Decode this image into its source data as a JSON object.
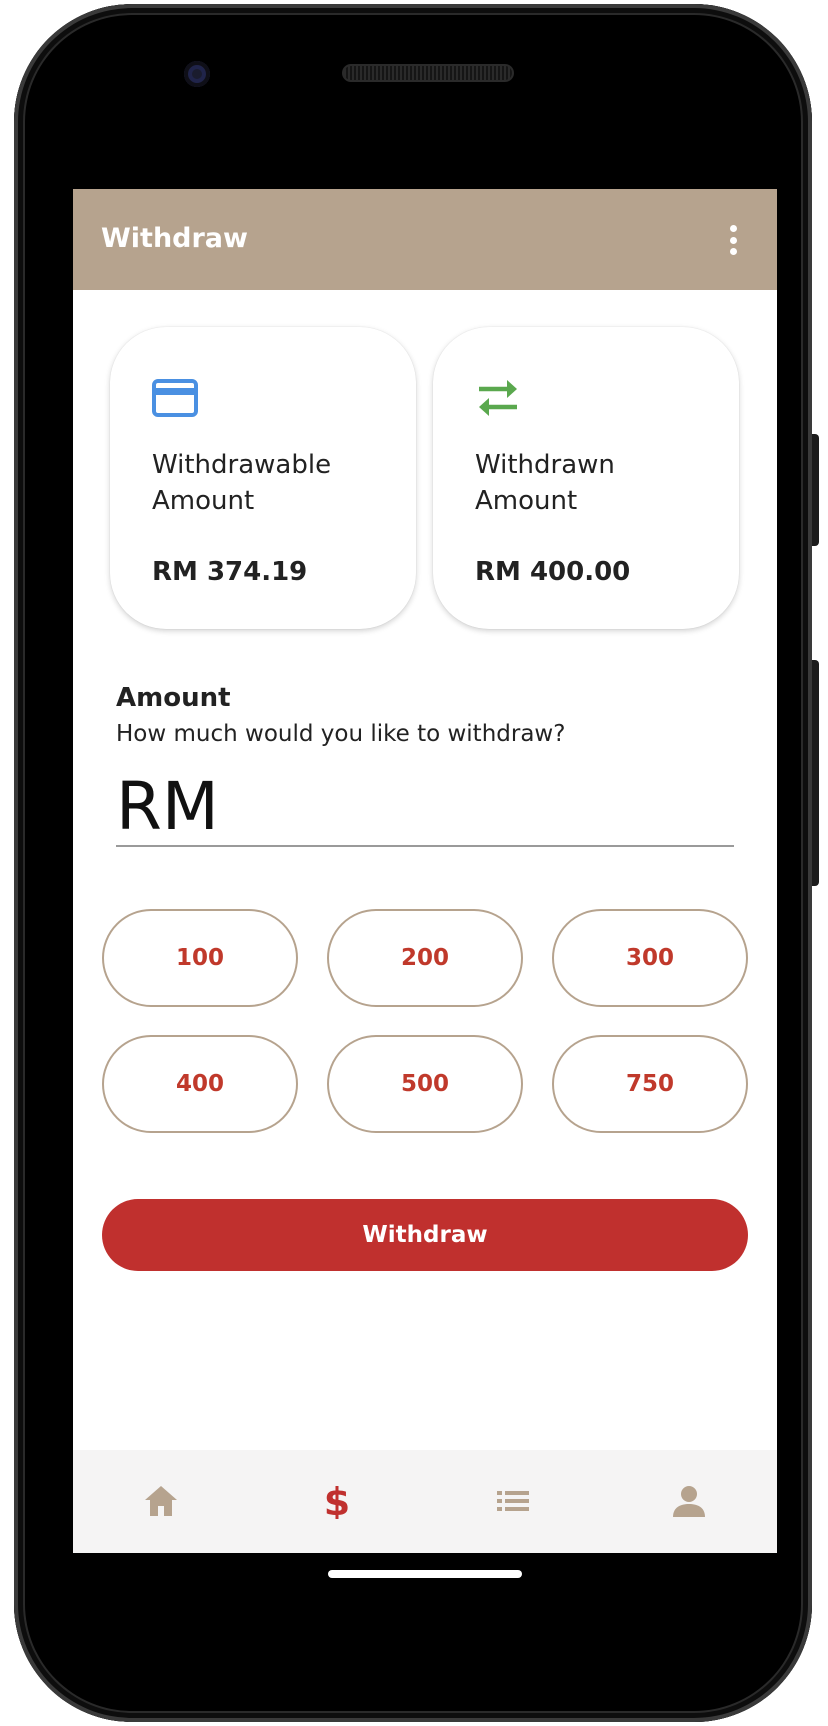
{
  "app_bar": {
    "title": "Withdraw",
    "menu_icon": "more-vertical-icon",
    "color": "#b6a38e"
  },
  "summary_cards": [
    {
      "icon": "credit-card-icon",
      "icon_color": "#4a90e2",
      "label": "Withdrawable Amount",
      "value": "RM 374.19"
    },
    {
      "icon": "swap-arrows-icon",
      "icon_color": "#5aa84e",
      "label": "Withdrawn Amount",
      "value": "RM 400.00"
    }
  ],
  "amount_section": {
    "label": "Amount",
    "hint": "How much would you like to withdraw?",
    "prefix": "RM",
    "value": ""
  },
  "quick_amounts": [
    "100",
    "200",
    "300",
    "400",
    "500",
    "750"
  ],
  "submit_button": {
    "label": "Withdraw",
    "color": "#c0302e"
  },
  "bottom_nav": {
    "items": [
      {
        "icon": "home-icon",
        "active": false
      },
      {
        "icon": "dollar-icon",
        "active": true
      },
      {
        "icon": "list-icon",
        "active": false
      },
      {
        "icon": "person-icon",
        "active": false
      }
    ],
    "active_color": "#c0302e",
    "inactive_color": "#b6a38e"
  }
}
